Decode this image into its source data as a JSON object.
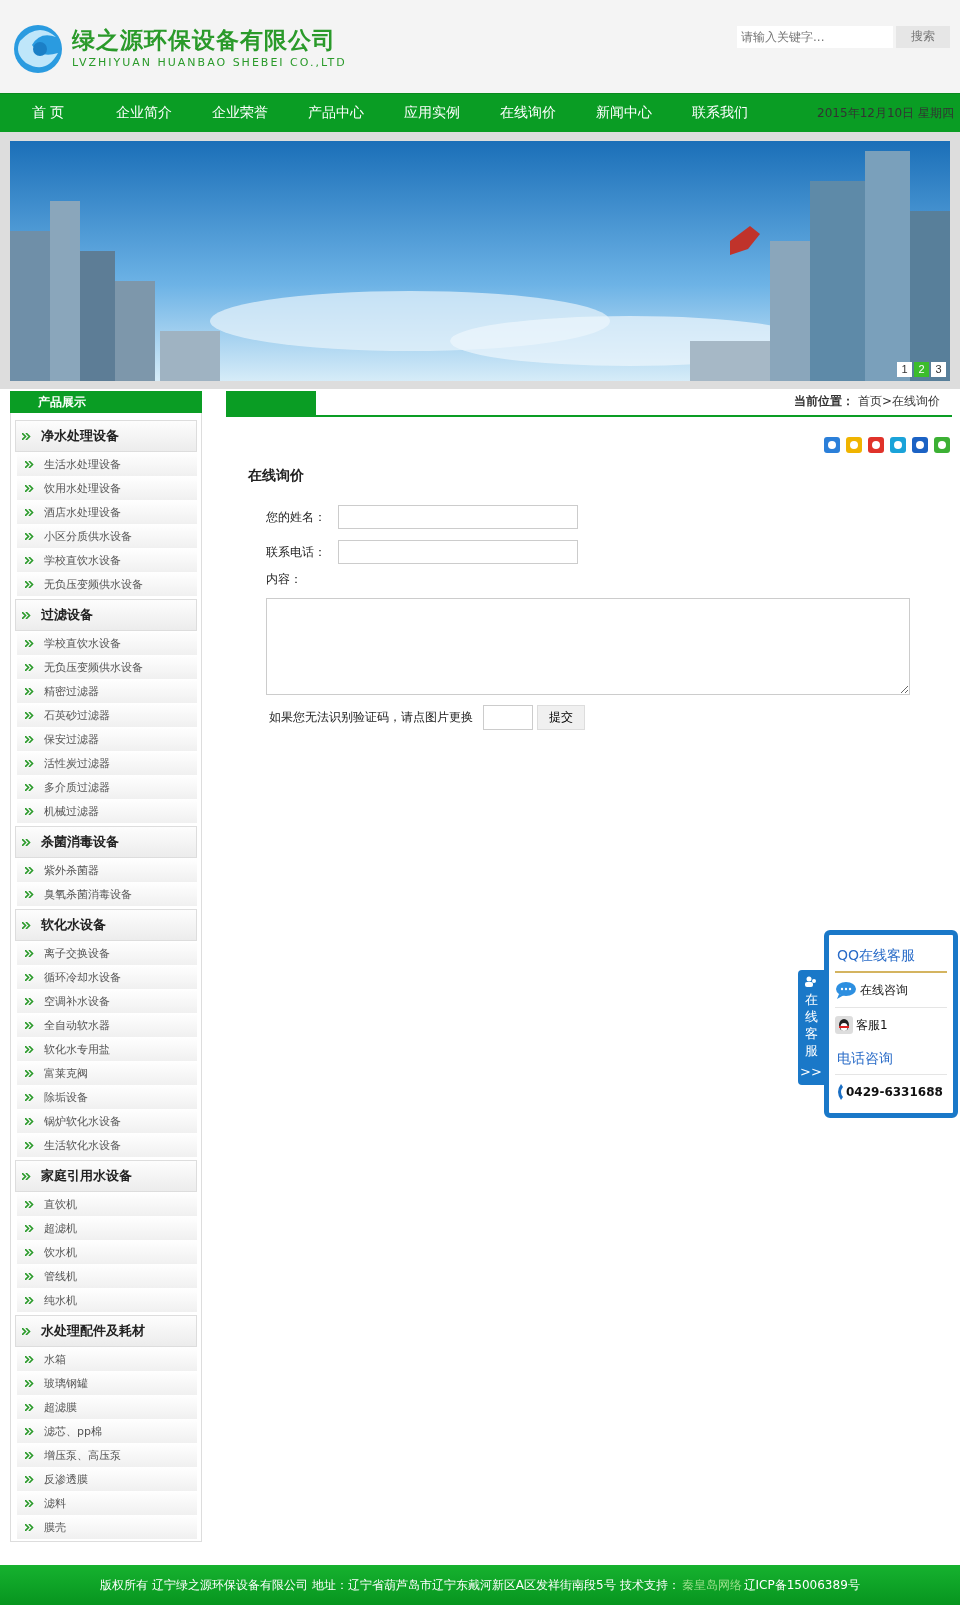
{
  "header": {
    "company_name": "绿之源环保设备有限公司",
    "company_name_en": "LVZHIYUAN HUANBAO SHEBEI CO.,LTD",
    "search": {
      "placeholder": "请输入关键字..."
    },
    "search_button": "搜索"
  },
  "nav": {
    "items": [
      {
        "label": "首 页",
        "selected": false
      },
      {
        "label": "企业简介",
        "selected": false
      },
      {
        "label": "企业荣誉",
        "selected": false
      },
      {
        "label": "产品中心",
        "selected": false
      },
      {
        "label": "应用实例",
        "selected": false
      },
      {
        "label": "在线询价",
        "selected": false
      },
      {
        "label": "新闻中心",
        "selected": false
      },
      {
        "label": "联系我们",
        "selected": false
      }
    ],
    "date": "2015年12月10日 星期四"
  },
  "banner": {
    "pages": [
      {
        "label": "1",
        "selected": false
      },
      {
        "label": "2",
        "selected": true
      },
      {
        "label": "3",
        "selected": false
      }
    ]
  },
  "sidebar": {
    "title": "产品展示",
    "categories": [
      {
        "label": "净水处理设备",
        "children": [
          "生活水处理设备",
          "饮用水处理设备",
          "酒店水处理设备",
          "小区分质供水设备",
          "学校直饮水设备",
          "无负压变频供水设备"
        ]
      },
      {
        "label": "过滤设备",
        "children": [
          "学校直饮水设备",
          "无负压变频供水设备",
          "精密过滤器",
          "石英砂过滤器",
          "保安过滤器",
          "活性炭过滤器",
          "多介质过滤器",
          "机械过滤器"
        ]
      },
      {
        "label": "杀菌消毒设备",
        "children": [
          "紫外杀菌器",
          "臭氧杀菌消毒设备"
        ]
      },
      {
        "label": "软化水设备",
        "children": [
          "离子交换设备",
          "循环冷却水设备",
          "空调补水设备",
          "全自动软水器",
          "软化水专用盐",
          "富莱克阀",
          "除垢设备",
          "锅炉软化水设备",
          "生活软化水设备"
        ]
      },
      {
        "label": "家庭引用水设备",
        "children": [
          "直饮机",
          "超滤机",
          "饮水机",
          "管线机",
          "纯水机"
        ]
      },
      {
        "label": "水处理配件及耗材",
        "children": [
          "水箱",
          "玻璃钢罐",
          "超滤膜",
          "滤芯、pp棉",
          "增压泵、高压泵",
          "反渗透膜",
          "滤料",
          "膜壳"
        ]
      }
    ]
  },
  "content": {
    "breadcrumb_label": "当前位置：",
    "breadcrumb": "首页>在线询价",
    "share_icons": [
      {
        "kind": "plus"
      },
      {
        "kind": "star"
      },
      {
        "kind": "weibo"
      },
      {
        "kind": "p"
      },
      {
        "kind": "person"
      },
      {
        "kind": "wechat"
      }
    ],
    "title": "在线询价",
    "fields": [
      {
        "label": "您的姓名："
      },
      {
        "label": "联系电话："
      }
    ],
    "message_label": "内容：",
    "captcha_text": "如果您无法识别验证码，请点图片更换",
    "submit": "提交"
  },
  "service": {
    "tab": "在线客服",
    "tab_arrow": ">>",
    "qq_title": "QQ在线客服",
    "consult": "在线咨询",
    "agent": "客服1",
    "phone_title": "电话咨询",
    "phone": "0429-6331688"
  },
  "footer": {
    "text_before": "版权所有 辽宁绿之源环保设备有限公司 地址：辽宁省葫芦岛市辽宁东戴河新区A区发祥街南段5号 技术支持：",
    "link": "秦皇岛网络",
    "text_after": "辽ICP备15006389号"
  }
}
